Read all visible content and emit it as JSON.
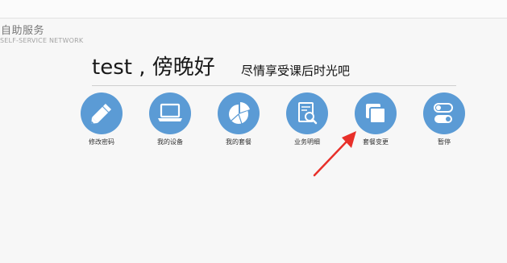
{
  "brand": {
    "title": "自助服务",
    "subtitle": "SELF-SERVICE NETWORK"
  },
  "greeting": {
    "text": "test , 傍晚好",
    "slogan": "尽情享受课后时光吧"
  },
  "tiles": [
    {
      "label": "修改密码",
      "icon": "pencil-icon"
    },
    {
      "label": "我的设备",
      "icon": "laptop-icon"
    },
    {
      "label": "我的套餐",
      "icon": "pie-chart-icon"
    },
    {
      "label": "业务明细",
      "icon": "document-search-icon"
    },
    {
      "label": "套餐变更",
      "icon": "copy-squares-icon"
    },
    {
      "label": "暂停",
      "icon": "toggle-switch-icon"
    }
  ],
  "colors": {
    "tile_circle": "#5b9bd5",
    "annotation_arrow": "#e8302a"
  }
}
